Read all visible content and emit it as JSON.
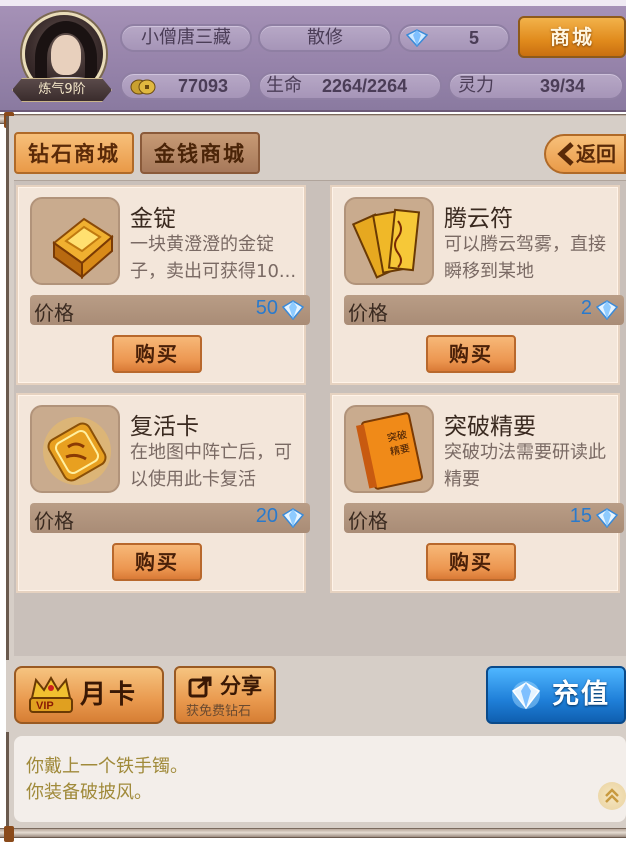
{
  "player": {
    "level_tag": "炼气9阶",
    "name": "小僧唐三藏",
    "sect": "散修",
    "diamonds": "5",
    "coins": "77093",
    "hp_label": "生命",
    "hp_value": "2264/2264",
    "mana_label": "灵力",
    "mana_value": "39/34"
  },
  "header": {
    "shop_button": "商城"
  },
  "tabs": {
    "diamond_shop": "钻石商城",
    "money_shop": "金钱商城",
    "back": "返回"
  },
  "items": [
    {
      "name": "金锭",
      "desc": "一块黄澄澄的金锭子，卖出可获得10...",
      "price_label": "价格",
      "price": "50",
      "buy": "购买",
      "icon": "gold-ingot-icon"
    },
    {
      "name": "腾云符",
      "desc": "可以腾云驾雾，直接瞬移到某地",
      "price_label": "价格",
      "price": "2",
      "buy": "购买",
      "icon": "cloud-talisman-icon"
    },
    {
      "name": "复活卡",
      "desc": "在地图中阵亡后，可以使用此卡复活",
      "price_label": "价格",
      "price": "20",
      "buy": "购买",
      "icon": "revive-card-icon"
    },
    {
      "name": "突破精要",
      "desc": "突破功法需要研读此精要",
      "price_label": "价格",
      "price": "15",
      "buy": "购买",
      "icon": "breakthrough-book-icon"
    }
  ],
  "book_text": {
    "line1": "突破",
    "line2": "精要"
  },
  "actions": {
    "vip_badge": "VIP",
    "monthly_card": "月卡",
    "share": "分享",
    "share_sub": "获免费钻石",
    "recharge": "充值"
  },
  "log": {
    "line1": "你戴上一个铁手镯。",
    "line2": "你装备破披风。"
  },
  "colors": {
    "price_blue": "#2a7acc",
    "log_text": "#a08a3a",
    "header_purple": "#9784ab"
  }
}
